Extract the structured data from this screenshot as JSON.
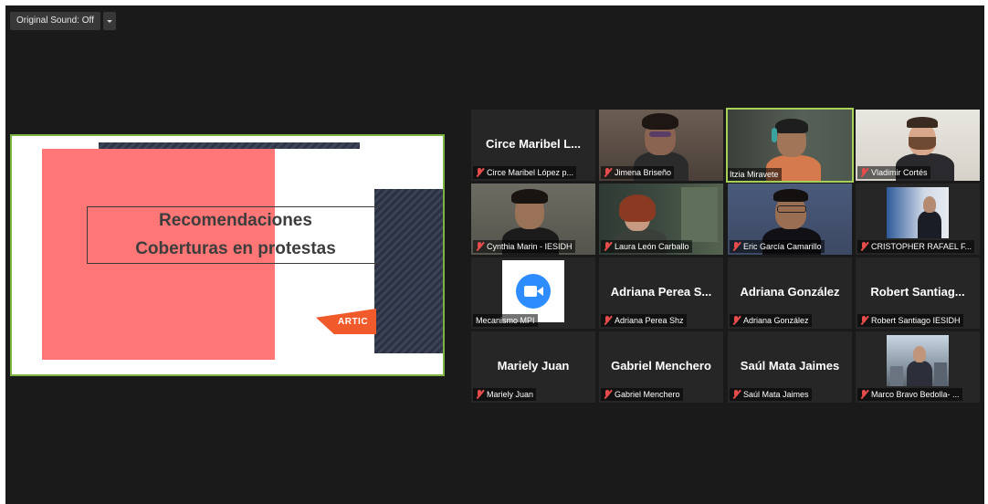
{
  "toolbar": {
    "original_sound_label": "Original Sound: Off",
    "dropdown_icon": "chevron-down-icon"
  },
  "slide": {
    "title_line1": "Recomendaciones",
    "title_line2": "Coberturas en protestas",
    "tag_text": "ARTIC"
  },
  "participants": [
    {
      "big_name": "Circe Maribel L...",
      "label": "Circe Maribel López p...",
      "muted": true,
      "video": false
    },
    {
      "big_name": "",
      "label": "Jimena Briseño",
      "muted": true,
      "video": true
    },
    {
      "big_name": "",
      "label": "Itzia Miravete",
      "muted": false,
      "video": true,
      "active": true
    },
    {
      "big_name": "",
      "label": "Vladimir Cortés",
      "muted": true,
      "video": true
    },
    {
      "big_name": "",
      "label": "Cynthia Marin - IESIDH",
      "muted": true,
      "video": true
    },
    {
      "big_name": "",
      "label": "Laura León Carballo",
      "muted": true,
      "video": true
    },
    {
      "big_name": "",
      "label": "Eric García Camarillo",
      "muted": true,
      "video": true
    },
    {
      "big_name": "",
      "label": "CRISTOPHER RAFAEL F...",
      "muted": true,
      "video": true
    },
    {
      "big_name": "",
      "label": "Mecanismo MPI",
      "muted": false,
      "video": false,
      "zoom_logo": true
    },
    {
      "big_name": "Adriana Perea S...",
      "label": "Adriana Perea Shz",
      "muted": true,
      "video": false
    },
    {
      "big_name": "Adriana González",
      "label": "Adriana González",
      "muted": true,
      "video": false
    },
    {
      "big_name": "Robert Santiag...",
      "label": "Robert Santiago IESIDH",
      "muted": true,
      "video": false
    },
    {
      "big_name": "Mariely Juan",
      "label": "Mariely Juan",
      "muted": true,
      "video": false
    },
    {
      "big_name": "Gabriel Menchero",
      "label": "Gabriel Menchero",
      "muted": true,
      "video": false
    },
    {
      "big_name": "Saúl Mata Jaimes",
      "label": "Saúl Mata Jaimes",
      "muted": true,
      "video": false
    },
    {
      "big_name": "",
      "label": "Marco Bravo Bedolla- ...",
      "muted": true,
      "video": true
    }
  ],
  "colors": {
    "background": "#1a1a1a",
    "tile_background": "#262626",
    "active_speaker_border": "#a8d058",
    "slide_border": "#7cb342",
    "slide_red": "#ff7676",
    "muted_icon": "#e74c4c"
  }
}
